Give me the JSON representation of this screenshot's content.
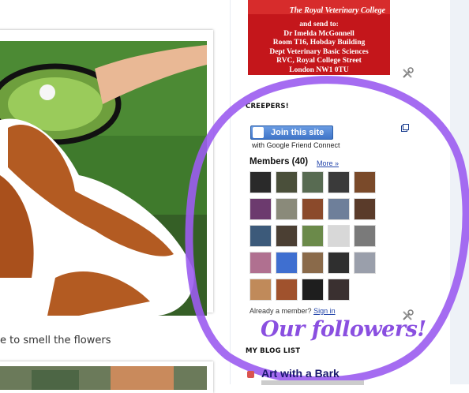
{
  "post": {
    "caption": "e to smell the flowers"
  },
  "rvc_card": {
    "title": "The Royal Veterinary College",
    "address_lines": [
      "and send to:",
      "Dr Imelda McGonnell",
      "Room T16, Hobday Building",
      "Dept Veterinary Basic Sciences",
      "RVC, Royal College Street",
      "London NW1 0TU"
    ]
  },
  "followers_widget": {
    "section_title": "CREEPERS!",
    "join_label": "Join this site",
    "gfc_text": "with Google Friend Connect",
    "members_label": "Members (40)",
    "more_label": "More »",
    "member_count_shown": 24,
    "already_member_text": "Already a member?",
    "sign_in_label": "Sign in"
  },
  "annotation": {
    "text": "Our followers!",
    "color": "#8a4fe0"
  },
  "blog_list": {
    "section_title": "MY BLOG LIST",
    "first_item": "Art with a Bark"
  },
  "colors": {
    "accent_purple": "#9b5cf0",
    "link_blue": "#2244aa",
    "rvc_red": "#c4161b"
  }
}
